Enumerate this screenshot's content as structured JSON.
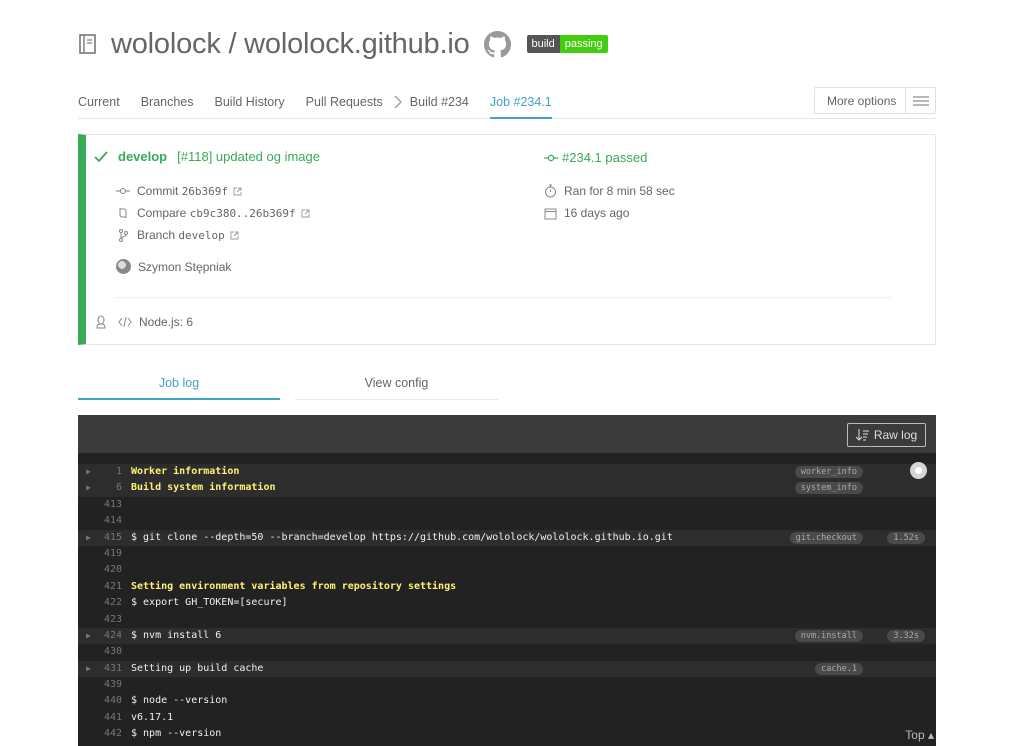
{
  "header": {
    "repo_title": "wololock / wololock.github.io",
    "badge_left": "build",
    "badge_right": "passing",
    "badge_colors": {
      "left": "#555555",
      "right": "#44cc11"
    }
  },
  "nav": {
    "current": "Current",
    "branches": "Branches",
    "build_history": "Build History",
    "pull_requests": "Pull Requests",
    "build": "Build #234",
    "job": "Job #234.1",
    "more_options": "More options"
  },
  "build": {
    "status_color": "#39aa56",
    "branch": "develop",
    "message": "[#118] updated og image",
    "job_status": "#234.1 passed",
    "commit_label": "Commit",
    "commit_hash": "26b369f",
    "compare_label": "Compare",
    "compare_range": "cb9c380..26b369f",
    "branch_label": "Branch",
    "branch_name": "develop",
    "author": "Szymon Stępniak",
    "duration": "Ran for 8 min 58 sec",
    "finished": "16 days ago",
    "language": "Node.js: 6"
  },
  "log_tabs": {
    "job_log": "Job log",
    "view_config": "View config"
  },
  "log": {
    "raw_log": "Raw log",
    "top_link": "Top",
    "lines": [
      {
        "num": "1",
        "text": "Worker information",
        "yellow": true,
        "fold": true,
        "tag": "worker_info"
      },
      {
        "num": "6",
        "text": "Build system information",
        "yellow": true,
        "fold": true,
        "tag": "system_info"
      },
      {
        "num": "413",
        "text": ""
      },
      {
        "num": "414",
        "text": ""
      },
      {
        "num": "415",
        "text": "$ git clone --depth=50 --branch=develop https://github.com/wololock/wololock.github.io.git",
        "fold": true,
        "tag": "git.checkout",
        "time": "1.52s"
      },
      {
        "num": "419",
        "text": ""
      },
      {
        "num": "420",
        "text": ""
      },
      {
        "num": "421",
        "text": "Setting environment variables from repository settings",
        "yellow": true
      },
      {
        "num": "422",
        "text": "$ export GH_TOKEN=[secure]"
      },
      {
        "num": "423",
        "text": ""
      },
      {
        "num": "424",
        "text": "$ nvm install 6",
        "fold": true,
        "tag": "nvm.install",
        "time": "3.32s"
      },
      {
        "num": "430",
        "text": ""
      },
      {
        "num": "431",
        "text": "Setting up build cache",
        "fold": true,
        "tag": "cache.1"
      },
      {
        "num": "439",
        "text": ""
      },
      {
        "num": "440",
        "text": "$ node --version"
      },
      {
        "num": "441",
        "text": "v6.17.1"
      },
      {
        "num": "442",
        "text": "$ npm --version"
      }
    ]
  }
}
